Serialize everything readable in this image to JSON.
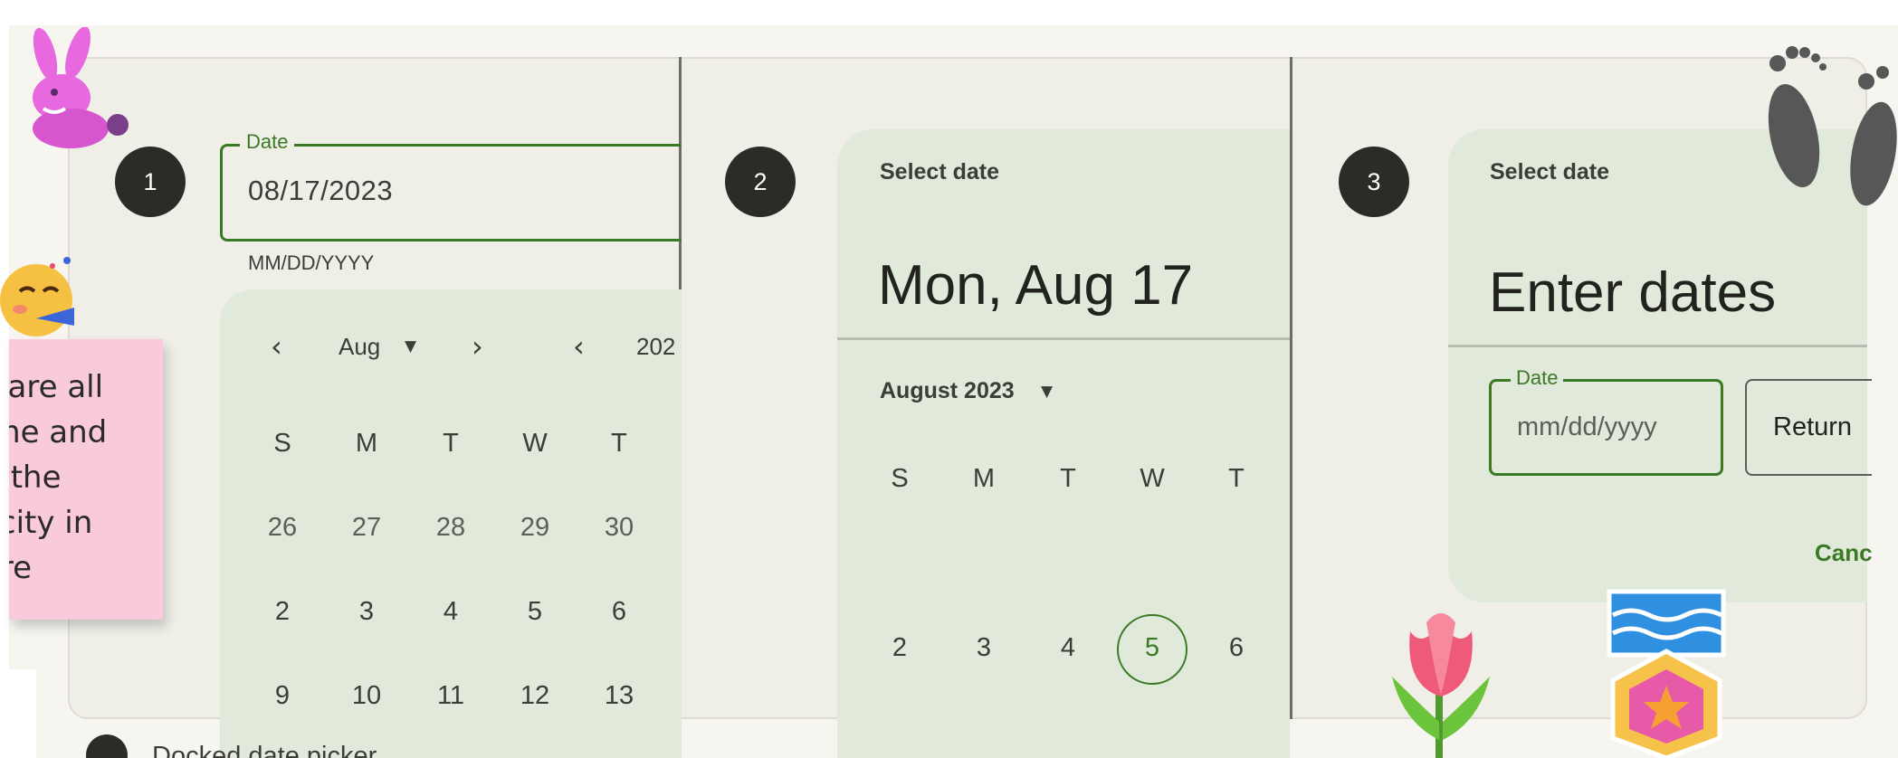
{
  "panel1": {
    "step": "1",
    "field_label": "Date",
    "field_value": "08/17/2023",
    "helper": "MM/DD/YYYY",
    "month": "Aug",
    "year": "202",
    "weekdays": [
      "S",
      "M",
      "T",
      "W",
      "T"
    ],
    "rows": [
      [
        "26",
        "27",
        "28",
        "29",
        "30"
      ],
      [
        "2",
        "3",
        "4",
        "5",
        "6"
      ],
      [
        "9",
        "10",
        "11",
        "12",
        "13"
      ]
    ]
  },
  "panel2": {
    "step": "2",
    "supporting": "Select date",
    "headline": "Mon, Aug 17",
    "month_year": "August 2023",
    "weekdays": [
      "S",
      "M",
      "T",
      "W",
      "T"
    ],
    "row": [
      "2",
      "3",
      "4",
      "5",
      "6"
    ],
    "selected_index": 3
  },
  "panel3": {
    "step": "3",
    "supporting": "Select date",
    "headline": "Enter dates",
    "field_label": "Date",
    "field_placeholder": "mm/dd/yyyy",
    "return_label": "Return",
    "cancel_label": "Canc"
  },
  "sticky_note": {
    "text": "s are all\nime and\ne the\nlicity in\nere"
  },
  "caption": "Docked date picker",
  "colors": {
    "primary": "#3b7a25",
    "surface": "#e0e9da",
    "sticky": "#f9c9dc"
  },
  "stickers": [
    "bunny-sticker",
    "party-face-sticker",
    "footprints-sticker",
    "tulip-sticker",
    "medal-sticker"
  ]
}
